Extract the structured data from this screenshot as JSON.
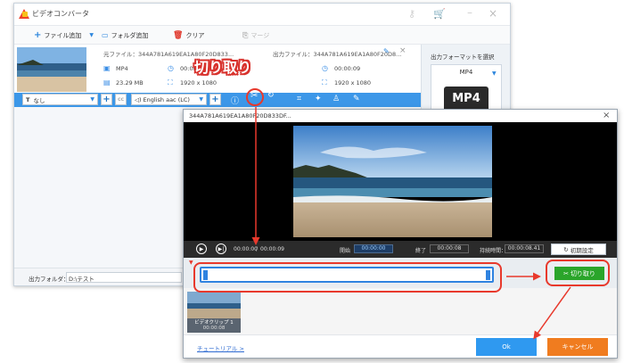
{
  "app": {
    "title": "ビデオコンバータ"
  },
  "toolbar": {
    "add_file": "ファイル追加",
    "add_folder": "フォルダ追加",
    "clear": "クリア",
    "merge": "マージ"
  },
  "file": {
    "source_label": "元ファイル：344A781A619EA1A80F20D833...",
    "output_label": "出力ファイル：344A781A619EA1A80F20D8...",
    "src_format": "MP4",
    "src_duration": "00:00:09",
    "src_size": "23.29 MB",
    "src_resolution": "1920 x 1080",
    "out_duration": "00:00:09",
    "out_resolution": "1920 x 1080"
  },
  "editbar": {
    "subtitle": "なし",
    "audio": "English aac (LC)"
  },
  "format_panel": {
    "label": "出力フォーマットを選択",
    "selected": "MP4",
    "icon_text": "MP4"
  },
  "output": {
    "label": "出力フォルダ：",
    "path": "D:\\テスト"
  },
  "annotation": {
    "title": "切り取り"
  },
  "dialog": {
    "title": "344A781A619EA1A80F20D833DF...",
    "time_current": "00:00:00",
    "time_total": "00:00:09",
    "start_label": "開始",
    "start_value": "00:00:00",
    "end_label": "終了",
    "end_value": "00:00:08",
    "duration_label": "持続時間：",
    "duration_value": "00:00:08.41",
    "reset": "初期設定",
    "cut": "切り取り",
    "clip_name": "ビデオクリップ 1",
    "clip_time": "00:00:08",
    "tutorial": "チュートリアル >",
    "ok": "Ok",
    "cancel": "キャンセル"
  },
  "colors": {
    "accent": "#3c97e8",
    "annotation_red": "#e8392c",
    "cut_green": "#2aa52a",
    "cancel_orange": "#f07c1f"
  }
}
